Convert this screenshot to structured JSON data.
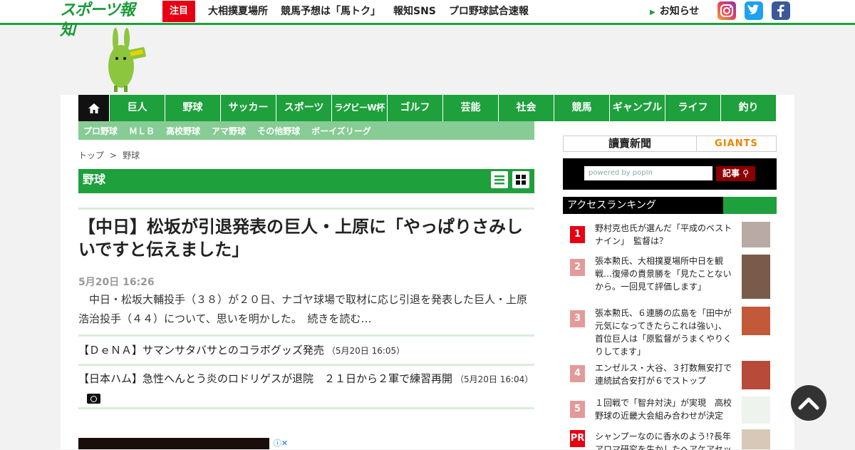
{
  "header": {
    "logo_text": "スポーツ報知",
    "highlight_label": "注目",
    "nav": [
      "大相撲夏場所",
      "競馬予想は「馬トク」",
      "報知SNS",
      "プロ野球試合速報"
    ],
    "notice_label": "お知らせ"
  },
  "main_nav": [
    "巨人",
    "野球",
    "サッカー",
    "スポーツ",
    "ラグビーW杯",
    "ゴルフ",
    "芸能",
    "社会",
    "競馬",
    "ギャンブル",
    "ライフ",
    "釣り"
  ],
  "sub_nav": [
    "プロ野球",
    "ＭＬＢ",
    "高校野球",
    "アマ野球",
    "その他野球",
    "ボーイズリーグ"
  ],
  "breadcrumb": {
    "home": "トップ",
    "sep": ">",
    "current": "野球"
  },
  "section_title": "野球",
  "article": {
    "headline": "【中日】松坂が引退発表の巨人・上原に「やっぱりさみしいですと伝えました」",
    "date": "5月20日 16:26",
    "lead": "中日・松坂大輔投手（３８）が２０日、ナゴヤ球場で取材に応じ引退を発表した巨人・上原浩治投手（４４）について、思いを明かした。",
    "more_label": "続きを読む…"
  },
  "related": [
    {
      "title": "【ＤｅＮＡ】サマンサタバサとのコラボグッズ発売",
      "time": "（5月20日 16:05）"
    },
    {
      "title": "【日本ハム】急性へんとう炎のロドリゲスが退院　２１日から２軍で練習再開",
      "time": "（5月20日 16:04）"
    }
  ],
  "sidebar": {
    "yomiuri_label": "讀賣新聞",
    "giants_label": "GIANTS",
    "search_placeholder": "powered by popIn",
    "search_button": "記事",
    "ranking_title": "アクセスランキング",
    "ranking": [
      {
        "rank": "1",
        "text": "野村克也氏が選んだ「平成のベストナイン」　監督は？"
      },
      {
        "rank": "2",
        "text": "張本勲氏、大相撲夏場所中日を観戦…復帰の貴景勝を「見たことないから。一回見て評価します」"
      },
      {
        "rank": "3",
        "text": "張本勲氏、６連勝の広島を「田中が元気になってきたらこれは強い」、首位巨人は「原監督がうまくやりくりしてます」"
      },
      {
        "rank": "4",
        "text": "エンゼルス・大谷、３打数無安打で連続試合安打が６でストップ"
      },
      {
        "rank": "5",
        "text": "１回戦で「智弁対決」が実現　高校野球の近畿大会組み合わせが決定"
      },
      {
        "rank": "PR",
        "text": "シャンプーなのに香水のよう!?長年アロマ研究を生かしたヘアケアセッ"
      }
    ]
  },
  "colors": {
    "brand_green": "#1ea03c",
    "accent_red": "#e60012",
    "rank_top": "#e60012",
    "rank_other": "#e39a9a"
  }
}
